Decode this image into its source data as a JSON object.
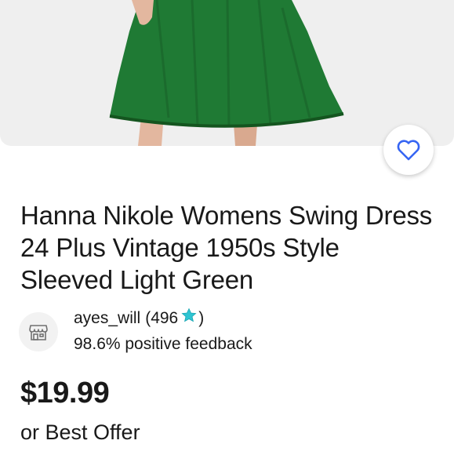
{
  "listing": {
    "title": "Hanna Nikole Womens Swing Dress 24 Plus Vintage 1950s Style Sleeved Light Green",
    "image": {
      "description_icon": "product-photo"
    },
    "watch_icon": "heart-outline-icon"
  },
  "seller": {
    "icon": "store-icon",
    "name": "ayes_will",
    "score_open": "(496",
    "score_close": ")",
    "star_icon": "star-icon",
    "feedback": "98.6% positive feedback"
  },
  "pricing": {
    "price": "$19.99",
    "offer_text": "or Best Offer"
  },
  "colors": {
    "accent_blue": "#3665f3",
    "dress_green": "#1f7a34",
    "star_teal": "#2fc4d2",
    "hero_bg": "#efefef"
  }
}
